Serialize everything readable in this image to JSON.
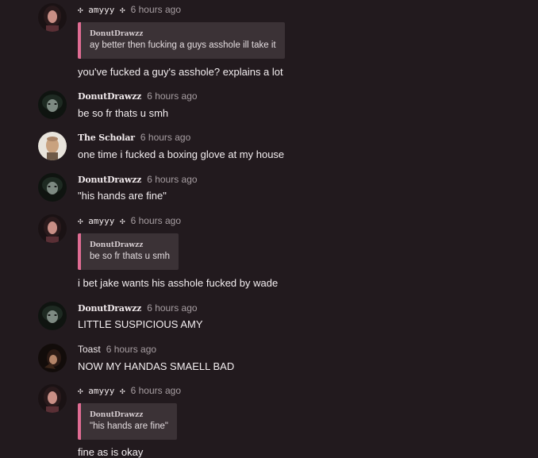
{
  "messages": [
    {
      "author": "✣ amyyy ✣",
      "time": "6 hours ago",
      "quote": {
        "author": "DonutDrawzz",
        "text": "ay better then fucking a guys asshole ill take it"
      },
      "text": "you've fucked a guy's asshole? explains a lot"
    },
    {
      "author": "DonutDrawzz",
      "time": "6 hours ago",
      "text": "be so fr thats u smh"
    },
    {
      "author": "The Scholar",
      "time": "6 hours ago",
      "text": "one time i fucked a boxing glove at my house"
    },
    {
      "author": "DonutDrawzz",
      "time": "6 hours ago",
      "text": "\"his hands are fine\""
    },
    {
      "author": "✣ amyyy ✣",
      "time": "6 hours ago",
      "quote": {
        "author": "DonutDrawzz",
        "text": "be so fr thats u smh"
      },
      "text": "i bet jake wants his asshole fucked by wade"
    },
    {
      "author": "DonutDrawzz",
      "time": "6 hours ago",
      "text": "LITTLE SUSPICIOUS AMY"
    },
    {
      "author": "Toast",
      "time": "6 hours ago",
      "text": "NOW MY HANDAS SMAELL BAD"
    },
    {
      "author": "✣ amyyy ✣",
      "time": "6 hours ago",
      "quote": {
        "author": "DonutDrawzz",
        "text": "\"his hands are fine\""
      },
      "text": "fine as is okay"
    }
  ]
}
